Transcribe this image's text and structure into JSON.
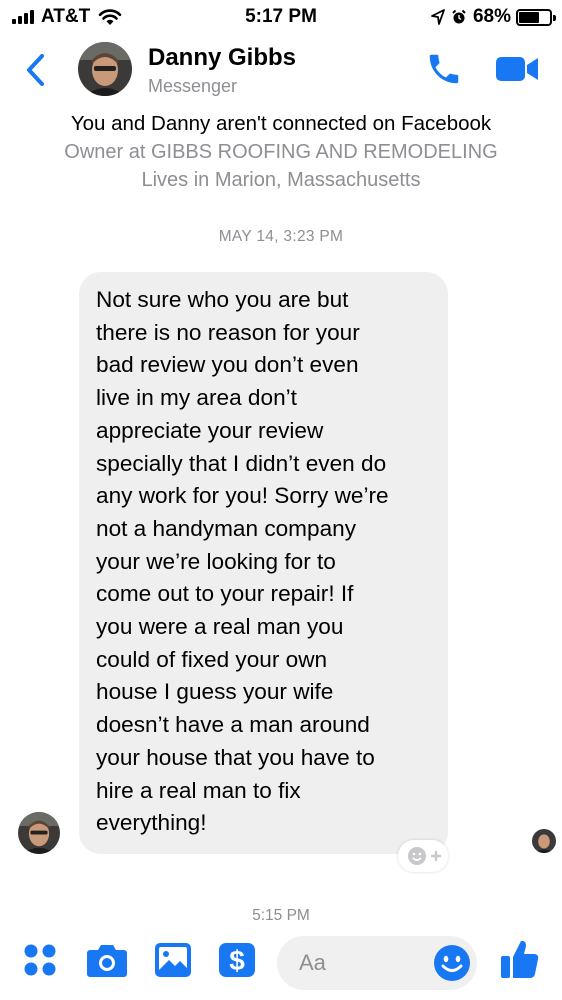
{
  "status_bar": {
    "carrier": "AT&T",
    "time": "5:17 PM",
    "battery": "68%",
    "battery_level": 0.68
  },
  "header": {
    "name": "Danny Gibbs",
    "subtitle": "Messenger",
    "icons": [
      "back-chevron-icon",
      "phone-icon",
      "video-camera-icon"
    ]
  },
  "info": {
    "connected": "You and Danny aren't connected on Facebook",
    "job": "Owner at GIBBS ROOFING AND REMODELING",
    "lives": "Lives in Marion, Massachusetts"
  },
  "conversation": {
    "timestamp": "MAY 14, 3:23 PM",
    "message_lines": [
      "Not sure who you are but",
      "there is no reason for your",
      "bad review you don’t even",
      "live in my area don’t",
      "appreciate your review",
      "specially that I didn’t even do",
      "any work for you! Sorry we’re",
      "not a handyman company",
      "your we’re looking for to",
      "come out to your repair! If",
      "you were a real man you",
      "could of fixed your own",
      "house I guess your wife",
      "doesn’t have a man around",
      "your house that you have to",
      "hire a real man to fix",
      "everything!"
    ],
    "next_timestamp": "5:15 PM"
  },
  "composer": {
    "placeholder": "Aa"
  },
  "colors": {
    "accent": "#1877f2",
    "bubble": "#efefef",
    "muted": "#8e8e93",
    "compose_bg": "#f0f0f0"
  }
}
